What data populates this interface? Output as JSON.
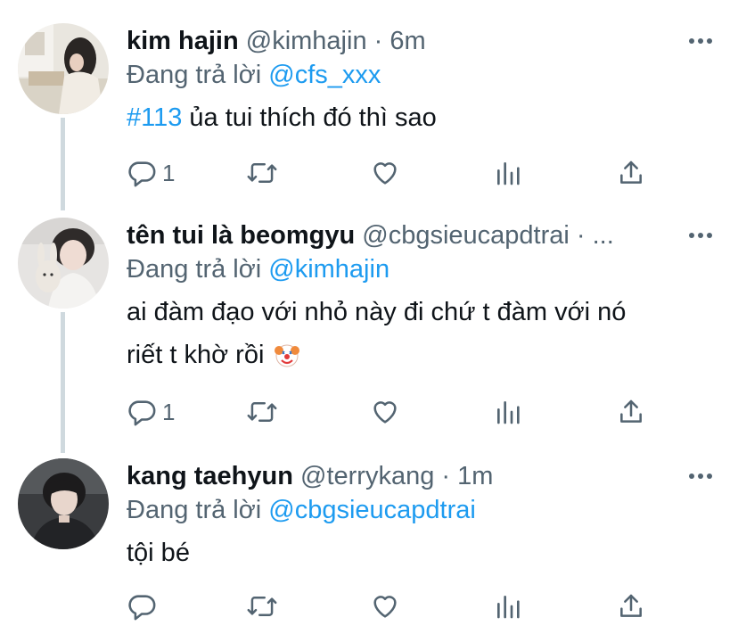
{
  "tweets": [
    {
      "name": "kim hajin",
      "handle": "@kimhajin",
      "separator": "·",
      "time": "6m",
      "reply_prefix": "Đang trả lời",
      "reply_to": "@cfs_xxx",
      "hashtag": "#113",
      "text": " ủa tui thích đó thì sao",
      "reply_count": "1",
      "avatar_icon": "person-photo-avatar"
    },
    {
      "name": "tên tui là beomgyu",
      "handle": "@cbgsieucapdtrai",
      "separator": "·",
      "time": "...",
      "reply_prefix": "Đang trả lời",
      "reply_to": "@kimhajin",
      "text_line1": "ai đàm đạo với nhỏ này đi chứ t đàm với nó",
      "text_line2": "riết t khờ rồi",
      "emoji": "clown-face-emoji",
      "reply_count": "1",
      "avatar_icon": "person-photo-avatar"
    },
    {
      "name": "kang taehyun",
      "handle": "@terrykang",
      "separator": "·",
      "time": "1m",
      "reply_prefix": "Đang trả lời",
      "reply_to": "@cbgsieucapdtrai",
      "text": "tội bé",
      "reply_count": "",
      "avatar_icon": "person-photo-avatar"
    }
  ],
  "icons": {
    "reply": "reply-icon",
    "retweet": "retweet-icon",
    "like": "heart-icon",
    "views": "analytics-icon",
    "share": "share-icon",
    "more": "more-dots-icon"
  },
  "colors": {
    "link": "#1d9bf0",
    "secondary_text": "#536471",
    "primary_text": "#0f1419",
    "thread_line": "#cfd9de"
  }
}
